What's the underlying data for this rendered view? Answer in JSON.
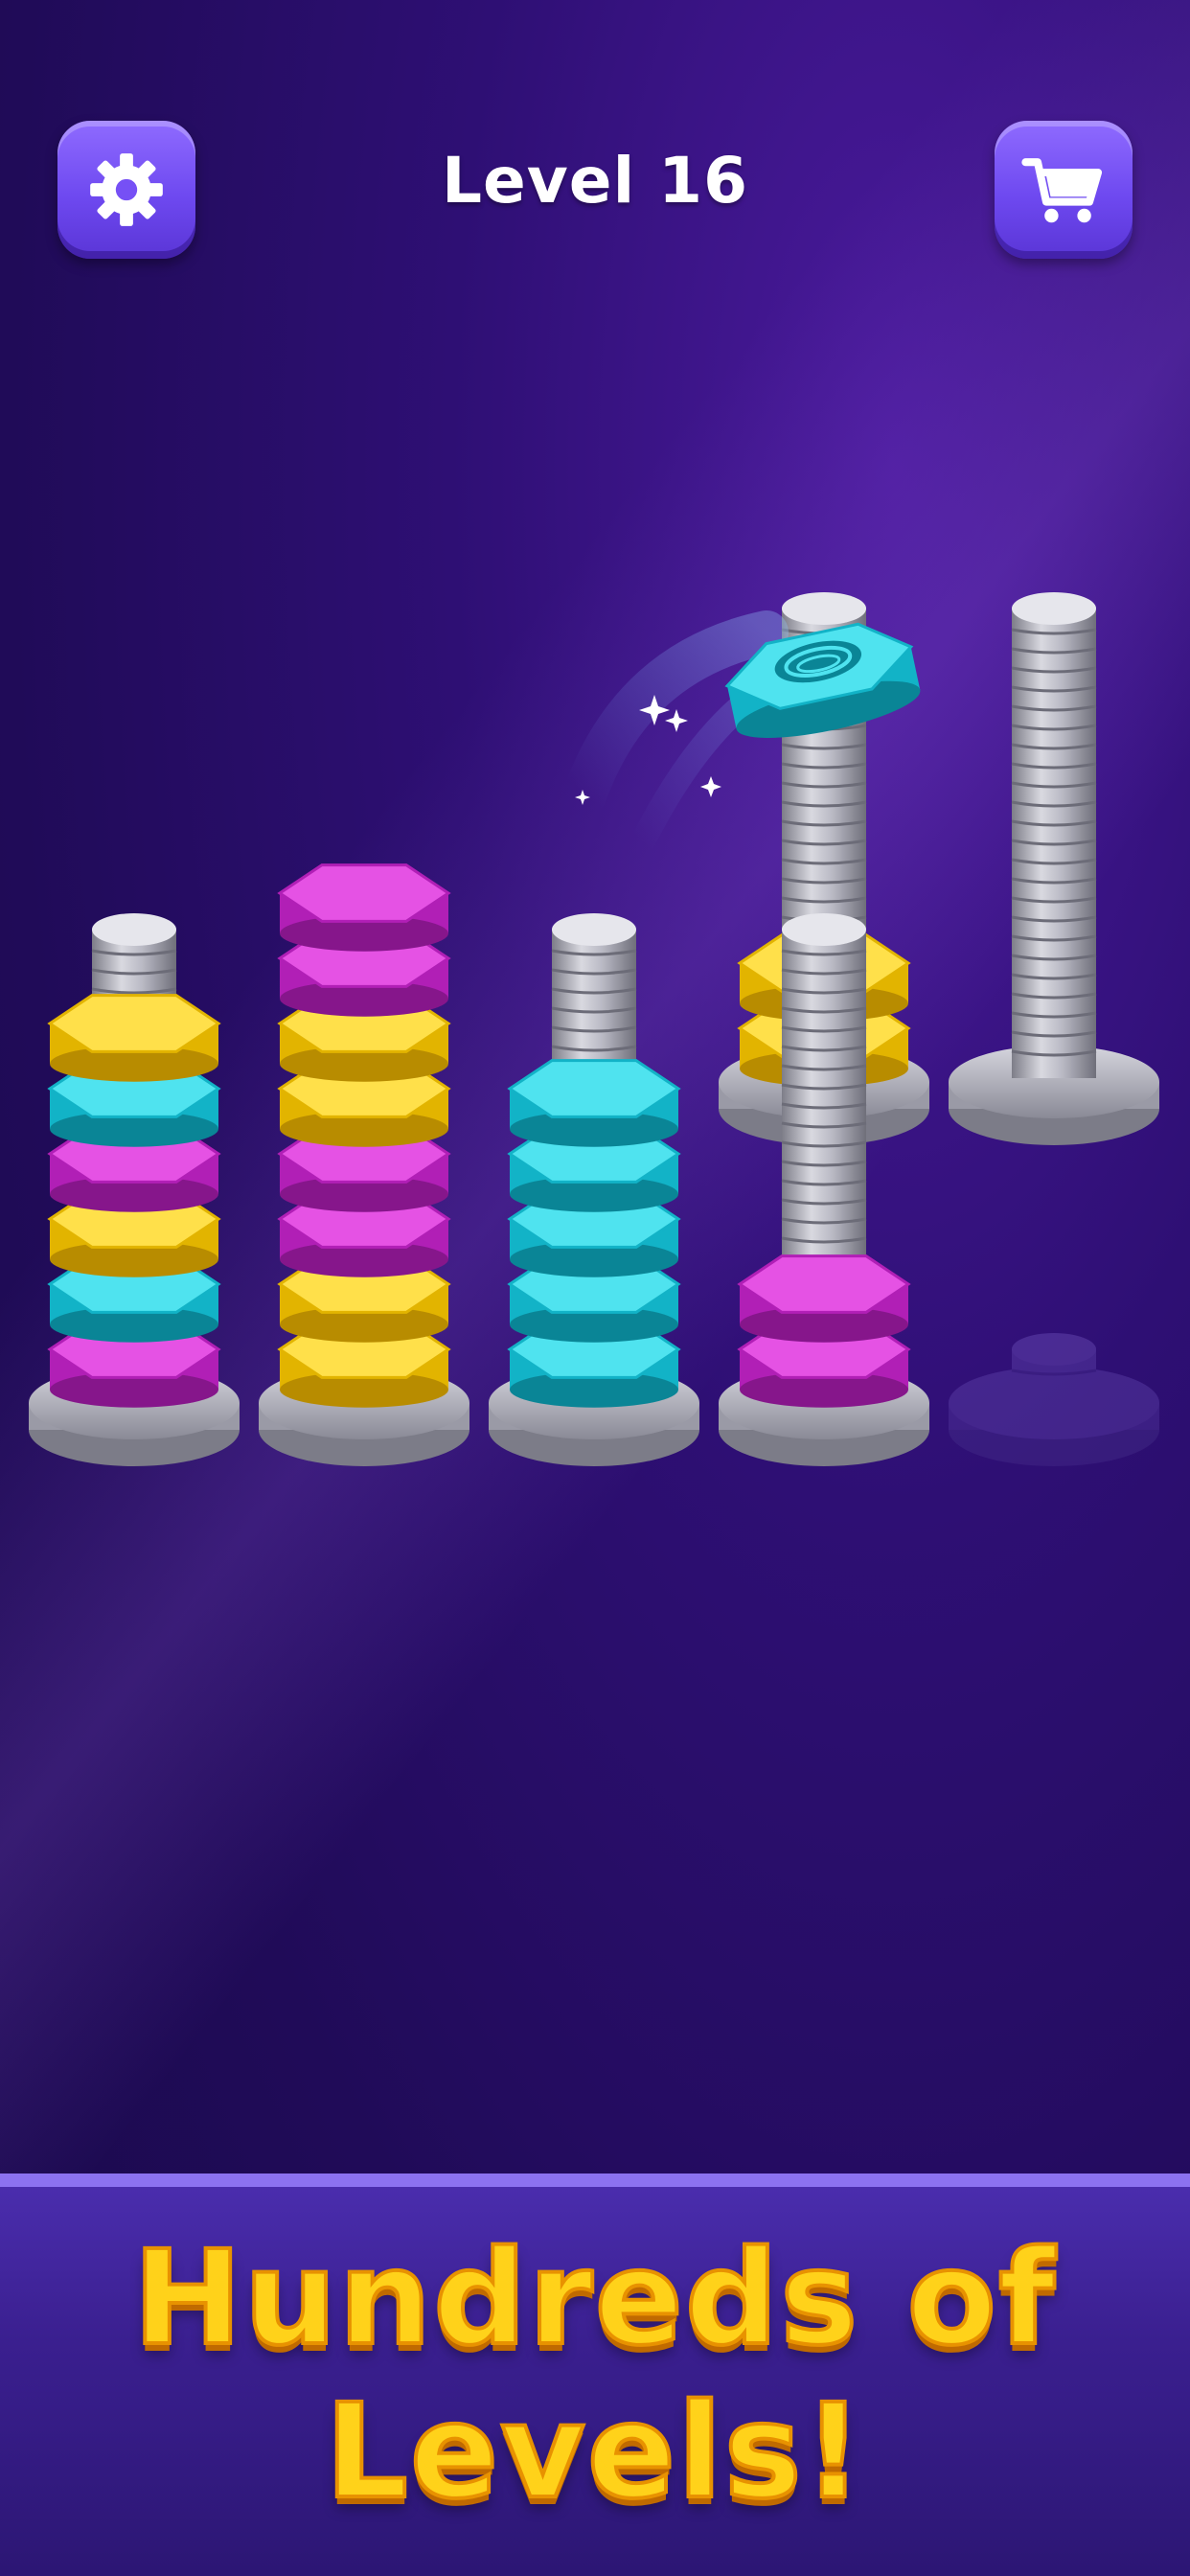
{
  "header": {
    "level_label": "Level 16",
    "settings_icon": "gear-icon",
    "shop_icon": "cart-icon"
  },
  "colors": {
    "yellow": "#f2c91c",
    "cyan": "#1fc6d8",
    "magenta": "#c42ec9",
    "button": "#7650f5",
    "banner_text": "#ffd21a"
  },
  "pegs": [
    {
      "nuts": [
        "magenta",
        "cyan",
        "yellow",
        "magenta",
        "cyan",
        "yellow"
      ]
    },
    {
      "nuts": [
        "yellow",
        "yellow",
        "magenta",
        "magenta",
        "yellow",
        "yellow",
        "magenta",
        "magenta"
      ]
    },
    {
      "nuts": [
        "cyan",
        "cyan",
        "cyan",
        "cyan",
        "cyan"
      ]
    },
    {
      "nuts": [
        "yellow",
        "yellow"
      ]
    },
    {
      "nuts": []
    },
    {
      "nuts": [
        "magenta",
        "magenta"
      ]
    },
    {
      "nuts": [],
      "locked": true
    }
  ],
  "flying_nut": {
    "color": "cyan"
  },
  "banner": {
    "line1": "Hundreds of",
    "line2": "Levels!"
  }
}
